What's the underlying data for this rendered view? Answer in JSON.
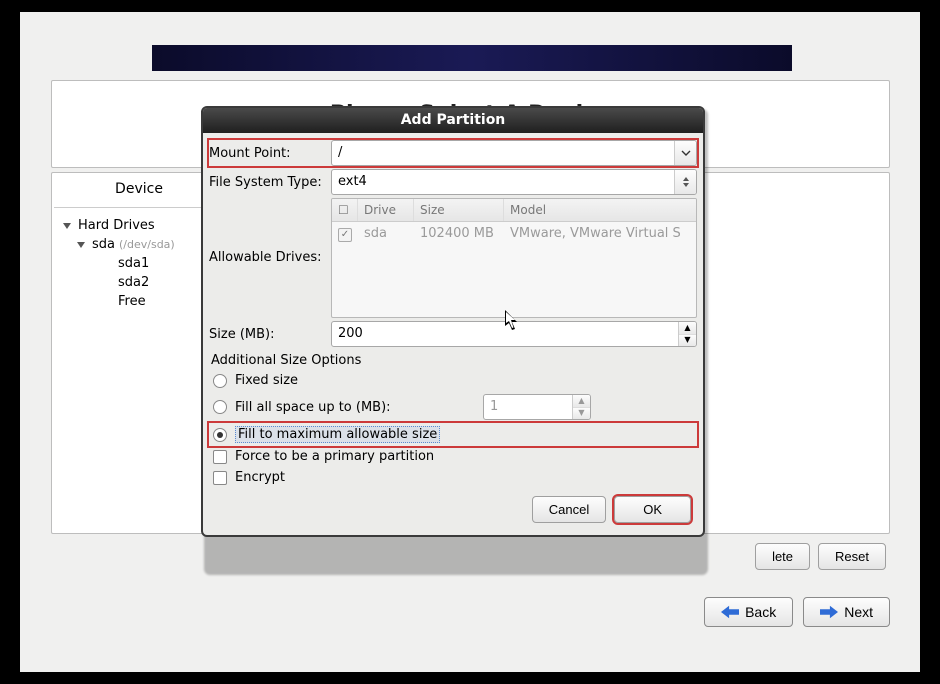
{
  "page": {
    "title": "Please Select A Device"
  },
  "tree": {
    "header": "Device",
    "root_label": "Hard Drives",
    "sda_label": "sda",
    "sda_path": "(/dev/sda)",
    "children": [
      "sda1",
      "sda2",
      "Free"
    ]
  },
  "bottom_buttons": {
    "delete": "lete",
    "reset": "Reset"
  },
  "nav": {
    "back": "Back",
    "next": "Next"
  },
  "dialog": {
    "title": "Add Partition",
    "labels": {
      "mount_point": "Mount Point:",
      "fs_type": "File System Type:",
      "allowable_drives": "Allowable Drives:",
      "size": "Size (MB):",
      "additional": "Additional Size Options",
      "fixed": "Fixed size",
      "fill_up_to": "Fill all space up to (MB):",
      "fill_max": "Fill to maximum allowable size",
      "force_primary": "Force to be a primary partition",
      "encrypt": "Encrypt"
    },
    "values": {
      "mount_point": "/",
      "fs_type": "ext4",
      "size": "200",
      "fill_up_to": "1"
    },
    "drives": {
      "headers": {
        "chk": "☐",
        "drive": "Drive",
        "size": "Size",
        "model": "Model"
      },
      "rows": [
        {
          "checked": true,
          "drive": "sda",
          "size": "102400 MB",
          "model": "VMware, VMware Virtual S"
        }
      ]
    },
    "radio_selected": "fill_max",
    "force_primary_checked": false,
    "encrypt_checked": false,
    "buttons": {
      "cancel": "Cancel",
      "ok": "OK"
    }
  }
}
